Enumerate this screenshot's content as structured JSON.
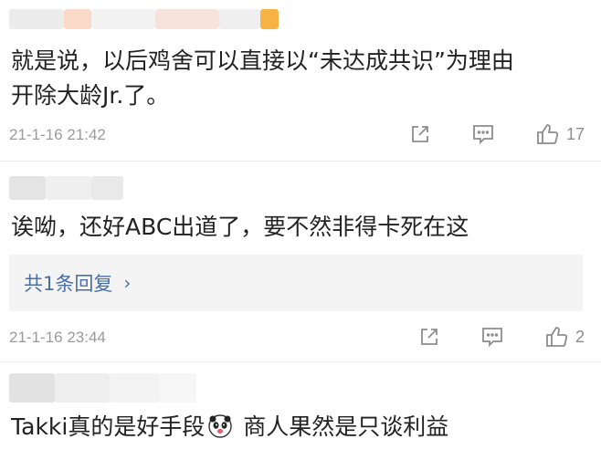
{
  "comments": [
    {
      "text_line1": "就是说，以后鸡舍可以直接以“未达成共识”为理由",
      "text_line2": "开除大龄Jr.了。",
      "timestamp": "21-1-16 21:42",
      "like_count": "17"
    },
    {
      "text_line1": "诶呦，还好ABC出道了，要不然非得卡死在这",
      "reply_label": "共1条回复",
      "reply_chevron": "›",
      "timestamp": "21-1-16 23:44",
      "like_count": "2"
    },
    {
      "text_before_emoji": "Takki真的是好手段",
      "text_after_emoji": " 商人果然是只谈利益"
    }
  ],
  "icons": {
    "share": "share-icon",
    "comment": "comment-icon",
    "like": "thumbs-up-icon",
    "emoji": "panda-emoji-icon"
  },
  "colors": {
    "link": "#4a6fa5",
    "meta": "#9a9a9a",
    "accent_orange": "#f5a623"
  }
}
